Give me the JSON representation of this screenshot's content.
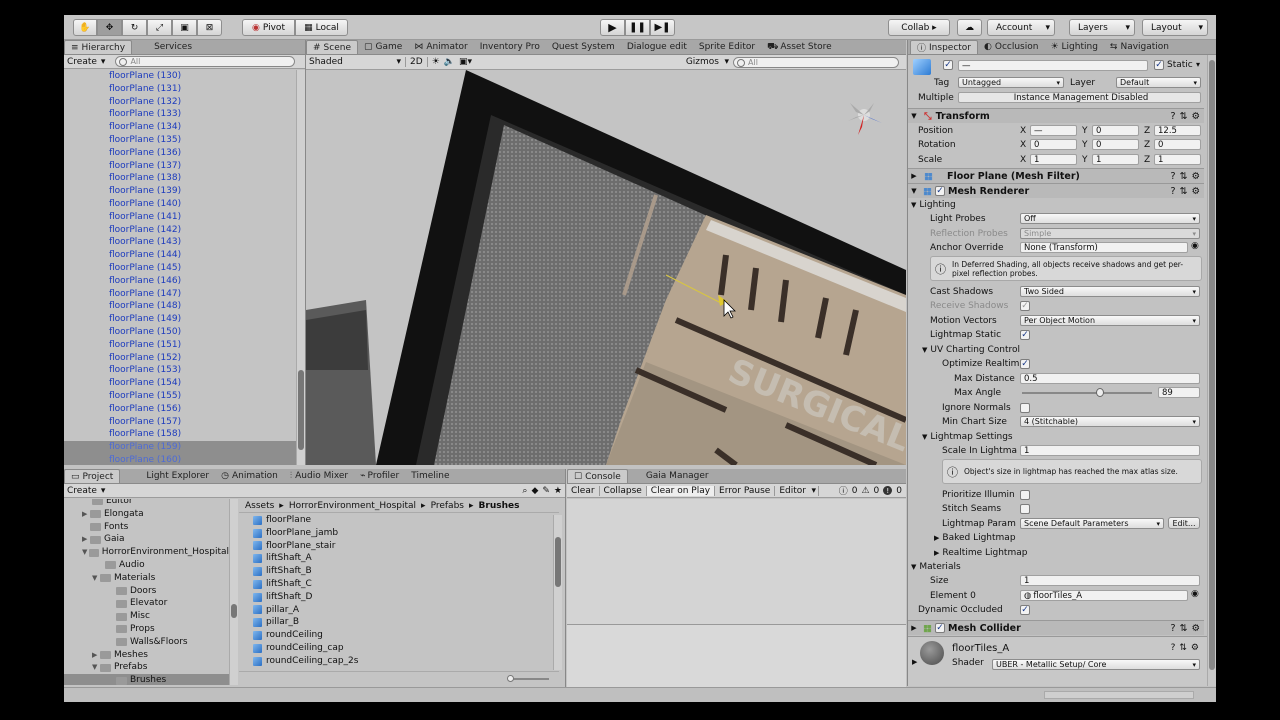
{
  "toolbar": {
    "tools": [
      "hand-tool",
      "move-tool",
      "rotate-tool",
      "scale-tool",
      "rect-tool",
      "transform-tool"
    ],
    "pivot": "Pivot",
    "local": "Local",
    "collab": "Collab ▸",
    "account": "Account",
    "layers": "Layers",
    "layout": "Layout"
  },
  "hierarchy": {
    "tabs": [
      "Hierarchy",
      "Services"
    ],
    "create": "Create",
    "search": "All",
    "items": [
      "floorPlane (130)",
      "floorPlane (131)",
      "floorPlane (132)",
      "floorPlane (133)",
      "floorPlane (134)",
      "floorPlane (135)",
      "floorPlane (136)",
      "floorPlane (137)",
      "floorPlane (138)",
      "floorPlane (139)",
      "floorPlane (140)",
      "floorPlane (141)",
      "floorPlane (142)",
      "floorPlane (143)",
      "floorPlane (144)",
      "floorPlane (145)",
      "floorPlane (146)",
      "floorPlane (147)",
      "floorPlane (148)",
      "floorPlane (149)",
      "floorPlane (150)",
      "floorPlane (151)",
      "floorPlane (152)",
      "floorPlane (153)",
      "floorPlane (154)",
      "floorPlane (155)",
      "floorPlane (156)",
      "floorPlane (157)",
      "floorPlane (158)",
      "floorPlane (159)",
      "floorPlane (160)"
    ]
  },
  "scene": {
    "tabs": [
      "Scene",
      "Game",
      "Animator",
      "Inventory Pro",
      "Quest System",
      "Dialogue edit",
      "Sprite Editor",
      "Asset Store"
    ],
    "shaded": "Shaded",
    "mode2d": "2D",
    "gizmos": "Gizmos",
    "search": "All",
    "sign_text": "SURGICAL CENTER"
  },
  "project": {
    "tabs": [
      "Project",
      "Light Explorer",
      "Animation",
      "Audio Mixer",
      "Profiler",
      "Timeline"
    ],
    "create": "Create",
    "tree": [
      "Editor",
      "Elongata",
      "Fonts",
      "Gaia",
      "HorrorEnvironment_Hospital",
      "Audio",
      "Materials",
      "Doors",
      "Elevator",
      "Misc",
      "Props",
      "Walls&Floors",
      "Meshes",
      "Prefabs",
      "Brushes"
    ],
    "breadcrumb": [
      "Assets",
      "HorrorEnvironment_Hospital",
      "Prefabs",
      "Brushes"
    ],
    "files": [
      "floorPlane",
      "floorPlane_jamb",
      "floorPlane_stair",
      "liftShaft_A",
      "liftShaft_B",
      "liftShaft_C",
      "liftShaft_D",
      "pillar_A",
      "pillar_B",
      "roundCeiling",
      "roundCeiling_cap",
      "roundCeiling_cap_2s"
    ]
  },
  "console": {
    "tabs": [
      "Console",
      "Gaia Manager"
    ],
    "clear": "Clear",
    "collapse": "Collapse",
    "clear_on_play": "Clear on Play",
    "error_pause": "Error Pause",
    "editor": "Editor",
    "count_log": "0",
    "count_warn": "0",
    "count_err": "0"
  },
  "inspector": {
    "tabs": [
      "Inspector",
      "Occlusion",
      "Lighting",
      "Navigation"
    ],
    "name": "—",
    "static": "Static",
    "tag_label": "Tag",
    "tag": "Untagged",
    "layer_label": "Layer",
    "layer": "Default",
    "multiple": "Multiple",
    "instance_mgmt": "Instance Management Disabled",
    "transform": {
      "title": "Transform",
      "position": "Position",
      "rotation": "Rotation",
      "scale": "Scale",
      "pos": [
        "—",
        "0",
        "12.5"
      ],
      "rot": [
        "0",
        "0",
        "0"
      ],
      "scl": [
        "1",
        "1",
        "1"
      ]
    },
    "mesh_filter": "Floor Plane (Mesh Filter)",
    "mesh_renderer": "Mesh Renderer",
    "lighting": "Lighting",
    "light_probes": "Light Probes",
    "light_probes_v": "Off",
    "refl_probes": "Reflection Probes",
    "refl_probes_v": "Simple",
    "anchor": "Anchor Override",
    "anchor_v": "None (Transform)",
    "deferred_note": "In Deferred Shading, all objects receive shadows and get per-pixel reflection probes.",
    "cast_shadows": "Cast Shadows",
    "cast_shadows_v": "Two Sided",
    "receive_shadows": "Receive Shadows",
    "motion_vectors": "Motion Vectors",
    "motion_vectors_v": "Per Object Motion",
    "lightmap_static": "Lightmap Static",
    "uv_charting": "UV Charting Control",
    "optimize": "Optimize Realtim",
    "max_distance": "Max Distance",
    "max_distance_v": "0.5",
    "max_angle": "Max Angle",
    "max_angle_v": "89",
    "max_angle_fraction": 0.6,
    "ignore_normals": "Ignore Normals",
    "min_chart": "Min Chart Size",
    "min_chart_v": "4 (Stitchable)",
    "lightmap_settings": "Lightmap Settings",
    "scale_lightmap": "Scale In Lightma",
    "scale_lightmap_v": "1",
    "atlas_note": "Object's size in lightmap has reached the max atlas size.",
    "prioritize": "Prioritize Illumin",
    "stitch": "Stitch Seams",
    "lightmap_param": "Lightmap Param",
    "lightmap_param_v": "Scene Default Parameters",
    "edit": "Edit...",
    "baked": "Baked Lightmap",
    "realtime": "Realtime Lightmap",
    "materials": "Materials",
    "size": "Size",
    "size_v": "1",
    "element0": "Element 0",
    "element0_v": "floorTiles_A",
    "dynamic_occluded": "Dynamic Occluded",
    "mesh_collider": "Mesh Collider",
    "material_name": "floorTiles_A",
    "shader_label": "Shader",
    "shader": "UBER - Metallic Setup/ Core"
  }
}
